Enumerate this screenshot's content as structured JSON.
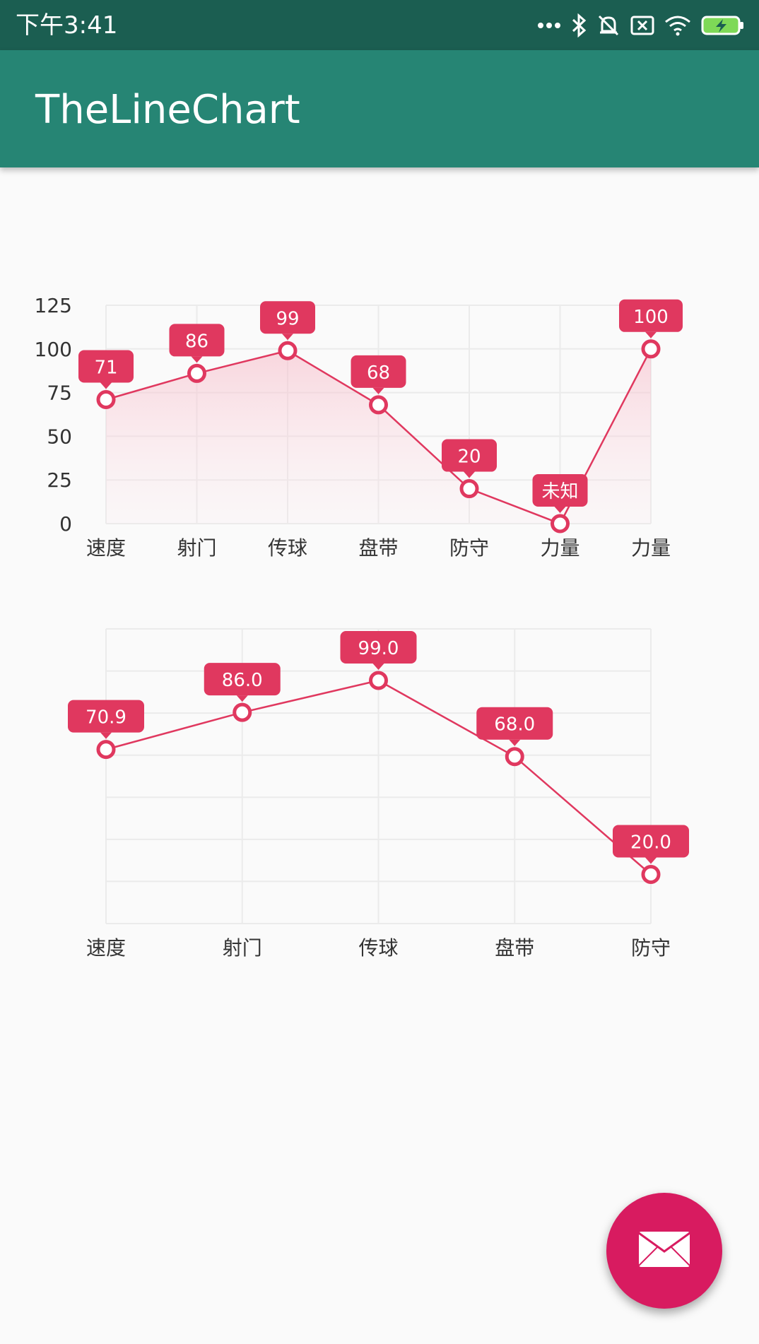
{
  "status_bar": {
    "time": "下午3:41",
    "icons": [
      "more-dots-icon",
      "bluetooth-icon",
      "alarm-off-icon",
      "sim-x-icon",
      "wifi-icon",
      "battery-charging-icon"
    ]
  },
  "app_bar": {
    "title": "TheLineChart"
  },
  "colors": {
    "status_bar": "#1b5e51",
    "app_bar": "#268574",
    "accent": "#e0385f",
    "fab": "#d81b60",
    "grid": "#ebebeb"
  },
  "chart_data": [
    {
      "type": "area",
      "categories": [
        "速度",
        "射门",
        "传球",
        "盘带",
        "防守",
        "力量",
        "力量"
      ],
      "values": [
        71,
        86,
        99,
        68,
        20,
        0,
        100
      ],
      "point_labels": [
        "71",
        "86",
        "99",
        "68",
        "20",
        "未知",
        "100"
      ],
      "y_ticks": [
        "0",
        "25",
        "50",
        "75",
        "100",
        "125"
      ],
      "ylim": [
        0,
        125
      ],
      "grid": true,
      "fill": "gradient"
    },
    {
      "type": "line",
      "categories": [
        "速度",
        "射门",
        "传球",
        "盘带",
        "防守"
      ],
      "values": [
        70.9,
        86.0,
        99.0,
        68.0,
        20.0
      ],
      "point_labels": [
        "70.9",
        "86.0",
        "99.0",
        "68.0",
        "20.0"
      ],
      "ylim": [
        0,
        120
      ],
      "grid": true,
      "y_axis_labels": false
    }
  ],
  "fab": {
    "icon": "mail-icon"
  }
}
